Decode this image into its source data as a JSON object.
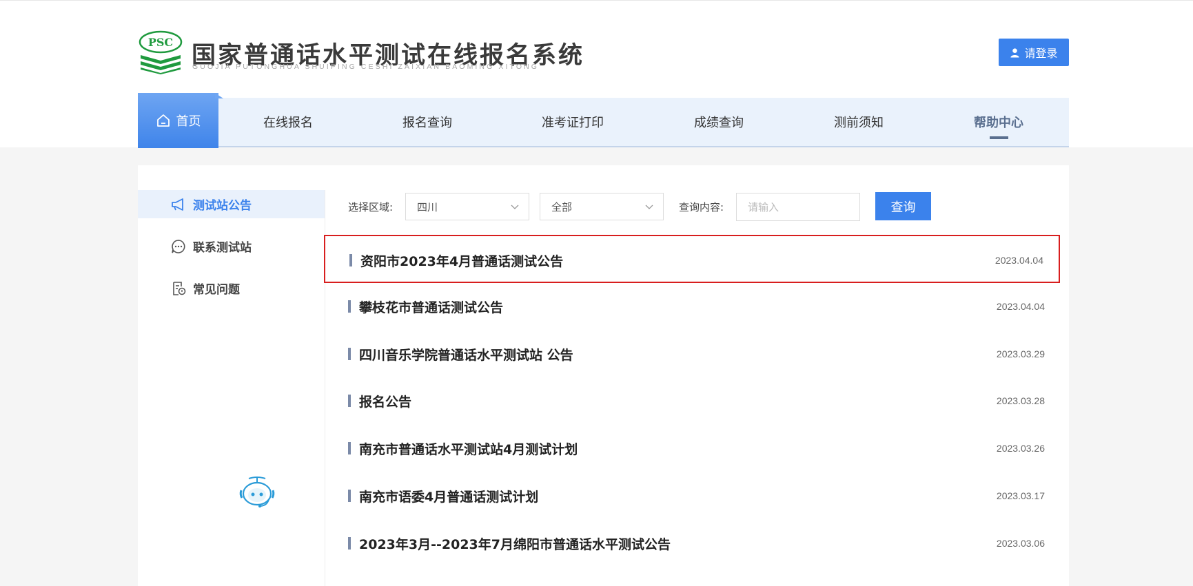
{
  "header": {
    "logo_text": "PSC",
    "title": "国家普通话水平测试在线报名系统",
    "subtitle": "GUOJIA PUTONGHUA SHUIPING CESHI ZAIXIAN BAOMING XITONG",
    "login_label": "请登录"
  },
  "nav": {
    "home": "首页",
    "items": [
      "在线报名",
      "报名查询",
      "准考证打印",
      "成绩查询",
      "测前须知",
      "帮助中心"
    ],
    "active": "帮助中心"
  },
  "sidebar": {
    "items": [
      {
        "label": "测试站公告",
        "icon": "megaphone-icon",
        "active": true
      },
      {
        "label": "联系测试站",
        "icon": "chat-bubble-icon",
        "active": false
      },
      {
        "label": "常见问题",
        "icon": "document-question-icon",
        "active": false
      }
    ],
    "assistant_icon": "robot-assistant-icon"
  },
  "filters": {
    "region_label": "选择区域:",
    "region_value": "四川",
    "category_value": "全部",
    "query_label": "查询内容:",
    "query_placeholder": "请输入",
    "query_button": "查询"
  },
  "announcements": [
    {
      "title": "资阳市2023年4月普通话测试公告",
      "date": "2023.04.04",
      "highlighted": true
    },
    {
      "title": "攀枝花市普通话测试公告",
      "date": "2023.04.04"
    },
    {
      "title": "四川音乐学院普通话水平测试站 公告",
      "date": "2023.03.29"
    },
    {
      "title": "报名公告",
      "date": "2023.03.28"
    },
    {
      "title": "南充市普通话水平测试站4月测试计划",
      "date": "2023.03.26"
    },
    {
      "title": "南充市语委4月普通话测试计划",
      "date": "2023.03.17"
    },
    {
      "title": "2023年3月--2023年7月绵阳市普通话水平测试公告",
      "date": "2023.03.06"
    }
  ],
  "colors": {
    "accent": "#3b82ec",
    "nav_bg": "#eaf2fc",
    "highlight_border": "#d81e1e",
    "logo_green": "#1f9a3e"
  }
}
